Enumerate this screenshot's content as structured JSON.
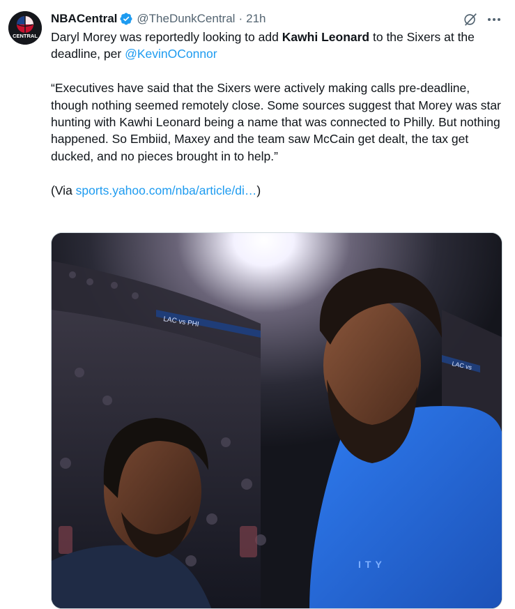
{
  "author": {
    "display_name": "NBACentral",
    "handle": "@TheDunkCentral",
    "separator": "·",
    "time": "21h",
    "avatar_text": "CENTRAL",
    "verified": true
  },
  "tweet": {
    "line1_pre": "Daryl Morey was reportedly looking to add ",
    "line1_bold": "Kawhi Leonard",
    "line1_post": " to the Sixers at the deadline, per ",
    "mention": "@KevinOConnor",
    "quote": "“Executives have said that the Sixers were actively making calls pre-deadline, though nothing seemed remotely close. Some sources suggest that Morey was star hunting with Kawhi Leonard being a name that was connected to Philly. But nothing happened. So Embiid, Maxey and the team saw McCain get dealt, the tax get ducked, and no pieces brought in to help.”",
    "via_pre": "(Via ",
    "via_link": "sports.yahoo.com/nba/article/di…",
    "via_post": ")"
  },
  "media": {
    "signage_left": "LAC vs PHI",
    "signage_right": "LAC vs",
    "jersey_text": "ITY"
  },
  "icons": {
    "verified": "verified-badge-icon",
    "grok": "grok-icon",
    "more": "more-horizontal-icon"
  },
  "colors": {
    "text": "#0f1419",
    "secondary": "#536471",
    "link": "#1d9bf0",
    "jersey_blue": "#1c5fc7"
  }
}
